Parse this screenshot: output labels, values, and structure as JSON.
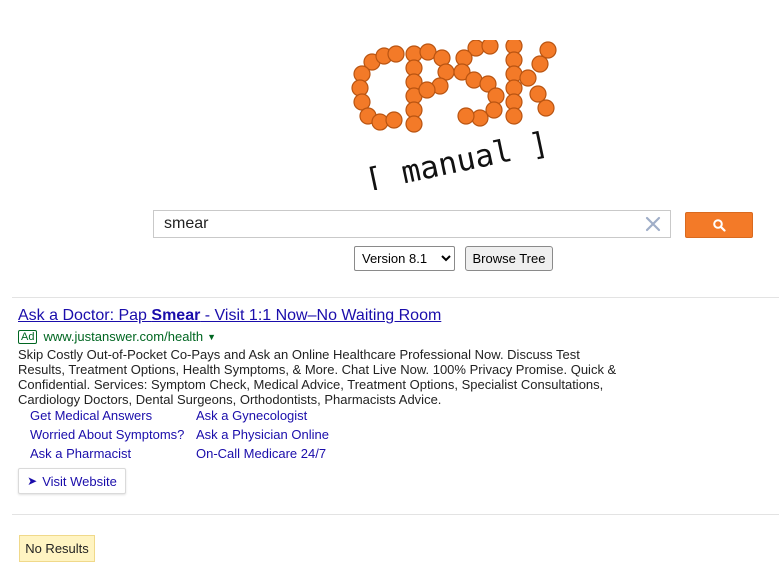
{
  "logo": {
    "brand": "CPSK",
    "tagline": "[ manual ]",
    "color": "#f37a28"
  },
  "search": {
    "value": "smear",
    "placeholder": "",
    "clear_icon": "close-icon",
    "button_icon": "search-icon",
    "button_color": "#f37a28"
  },
  "version": {
    "selected": "Version 8.1",
    "options": [
      "Version 8.1"
    ]
  },
  "browse_tree": {
    "label": "Browse Tree"
  },
  "ad": {
    "title_prefix": "Ask a Doctor: Pap ",
    "title_bold": "Smear",
    "title_suffix": " - Visit 1:1 Now–No Waiting Room",
    "badge": "Ad",
    "url": "www.justanswer.com/health",
    "url_arrow": "▼",
    "description": "Skip Costly Out-of-Pocket Co-Pays and Ask an Online Healthcare Professional Now. Discuss Test Results, Treatment Options, Health Symptoms, & More. Chat Live Now. 100% Privacy Promise. Quick & Confidential. Services: Symptom Check, Medical Advice, Treatment Options, Specialist Consultations, Cardiology Doctors, Dental Surgeons, Orthodontists, Pharmacists Advice.",
    "sitelinks": [
      "Get Medical Answers",
      "Ask a Gynecologist",
      "Worried About Symptoms?",
      "Ask a Physician Online",
      "Ask a Pharmacist",
      "On-Call Medicare 24/7"
    ],
    "visit_label": "Visit Website",
    "visit_icon": "arrow-right-icon",
    "link_color": "#1a0dab",
    "url_color": "#006621"
  },
  "status": {
    "no_results": "No Results"
  }
}
